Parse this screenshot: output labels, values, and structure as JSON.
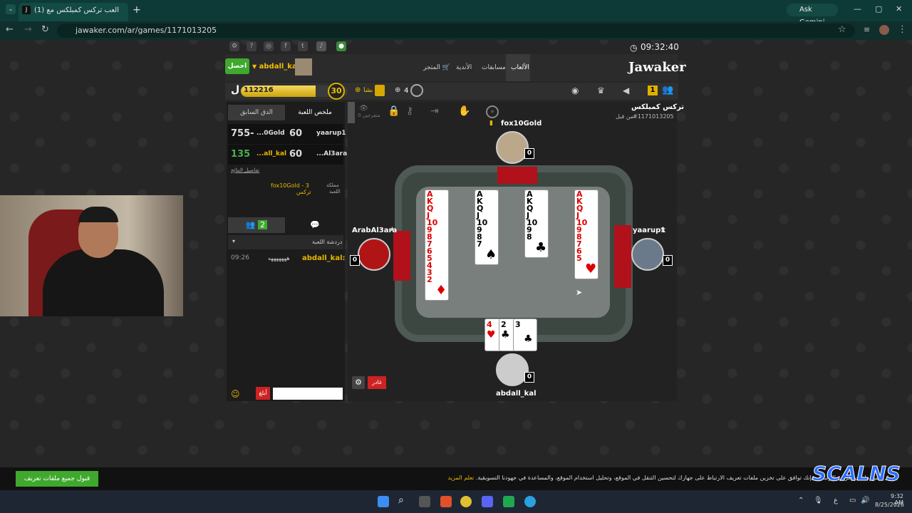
{
  "browser": {
    "tab_title": "(1) العب تركس كمبلكس مع",
    "url": "jawaker.com/ar/games/1171013205",
    "ask_gemini": "Ask Gemini"
  },
  "site": {
    "logo": "Jawaker",
    "clock": "09:32:40",
    "menu": [
      "الألعاب",
      "مسابقات",
      "الأندية",
      "المتجر"
    ],
    "login_button": "احصل",
    "username": "abdall_kal",
    "balance": "112216",
    "level": "30",
    "gold": "4",
    "badge_count": "1",
    "vip": "بشا"
  },
  "panel": {
    "tab_summary": "ملخص اللعبة",
    "tab_previous": "الدق السابق",
    "scores": [
      {
        "player": "yaarup1",
        "pts": "60",
        "opp": "...0Gold",
        "total": "755-",
        "total_color": "#ffffff"
      },
      {
        "player": "...Al3ara",
        "pts": "60",
        "opp": "...all_kal",
        "total": "135",
        "total_color": "#4caf50"
      }
    ],
    "details_link": "تفاصيل النتائج",
    "kingdom_label": "مملكة",
    "kingdom_value": "fox10Gold - 3",
    "game_label": "اللعبة",
    "game_value": "تركس",
    "friends_count": "2",
    "chat_header": "دردشة اللعبة",
    "chat": [
      {
        "time": "09:26",
        "user": "abdall_kal:",
        "msg": "هههههههه"
      }
    ],
    "send": "أبلغ"
  },
  "game": {
    "title": "تركس كمبلكس",
    "game_id": "#1171013205",
    "since": "من قبل",
    "spectators": "0 متفرجين",
    "players": {
      "top": {
        "name": "fox10Gold",
        "score": "0"
      },
      "left": {
        "name": "ArabAl3ara",
        "score": "0"
      },
      "right": {
        "name": "yaarup1",
        "score": "0"
      },
      "bottom": {
        "name": "abdall_kal",
        "score": "0"
      }
    },
    "columns": [
      {
        "suit": "♦",
        "color": "red",
        "ranks": [
          "A",
          "K",
          "Q",
          "J",
          "10",
          "9",
          "8",
          "7",
          "6",
          "5",
          "4",
          "3",
          "2"
        ]
      },
      {
        "suit": "♠",
        "color": "blk",
        "ranks": [
          "A",
          "K",
          "Q",
          "J",
          "10",
          "9",
          "8",
          "7"
        ]
      },
      {
        "suit": "♣",
        "color": "blk",
        "ranks": [
          "A",
          "K",
          "Q",
          "J",
          "10",
          "9",
          "8"
        ]
      },
      {
        "suit": "♥",
        "color": "red",
        "ranks": [
          "A",
          "K",
          "Q",
          "J",
          "10",
          "9",
          "8",
          "7",
          "6",
          "5"
        ]
      }
    ],
    "hand": [
      {
        "rank": "4",
        "suit": "♥",
        "color": "red"
      },
      {
        "rank": "2",
        "suit": "♣",
        "color": "blk"
      },
      {
        "rank": "3",
        "suit": "♣",
        "color": "blk"
      }
    ],
    "leave_button": "غادر"
  },
  "cookie": {
    "accept": "قبول جميع ملفات تعريف الارتباط",
    "text": "بقبول جميع ملفات تعريف الارتباط، فإنك توافق على تخزين ملفات تعريف الارتباط على جهازك لتحسين التنقل في الموقع، وتحليل استخدام الموقع، والمساعدة في جهودنا التسويقية.",
    "more": "تعلم المزيد"
  },
  "taskbar": {
    "time": "9:32 AM",
    "date": "8/25/2026",
    "lang": "ع"
  },
  "overlay_logo": "SCALNS"
}
